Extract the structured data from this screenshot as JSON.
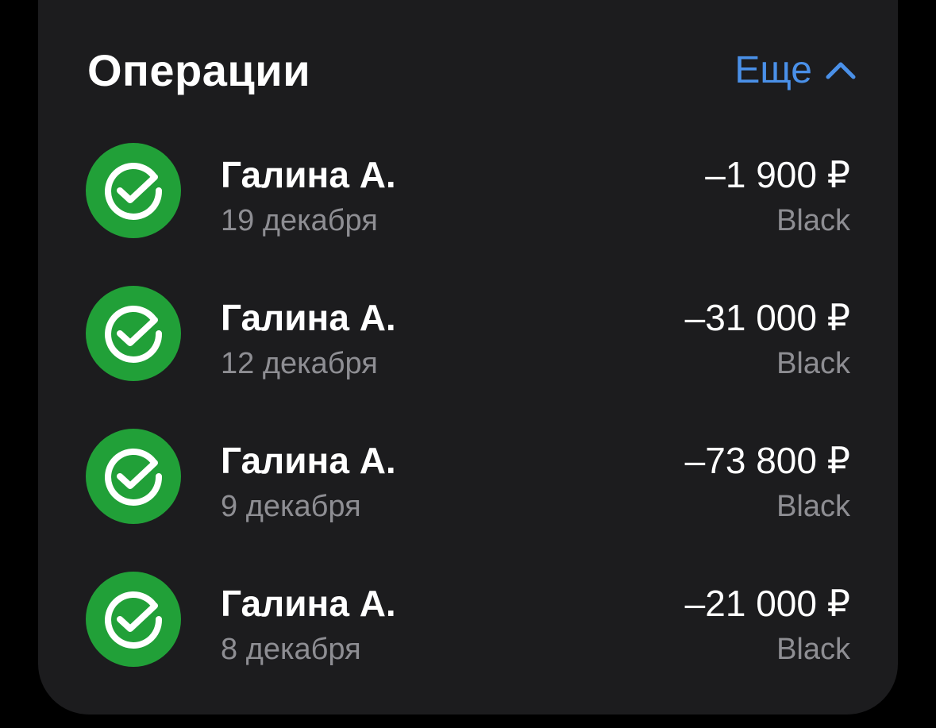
{
  "section": {
    "title": "Операции",
    "more_label": "Еще",
    "more_icon": "chevron-up-icon",
    "accent_color": "#4a90e8"
  },
  "transactions": [
    {
      "name": "Галина А.",
      "date": "19 декабря",
      "amount": "–1 900 ₽",
      "card": "Black",
      "icon": "sber-check-icon"
    },
    {
      "name": "Галина А.",
      "date": "12 декабря",
      "amount": "–31 000 ₽",
      "card": "Black",
      "icon": "sber-check-icon"
    },
    {
      "name": "Галина А.",
      "date": "9 декабря",
      "amount": "–73 800 ₽",
      "card": "Black",
      "icon": "sber-check-icon"
    },
    {
      "name": "Галина А.",
      "date": "8 декабря",
      "amount": "–21 000 ₽",
      "card": "Black",
      "icon": "sber-check-icon"
    }
  ],
  "colors": {
    "background": "#000000",
    "card": "#1c1c1e",
    "avatar": "#21a038",
    "secondary_text": "#8e8e93"
  }
}
